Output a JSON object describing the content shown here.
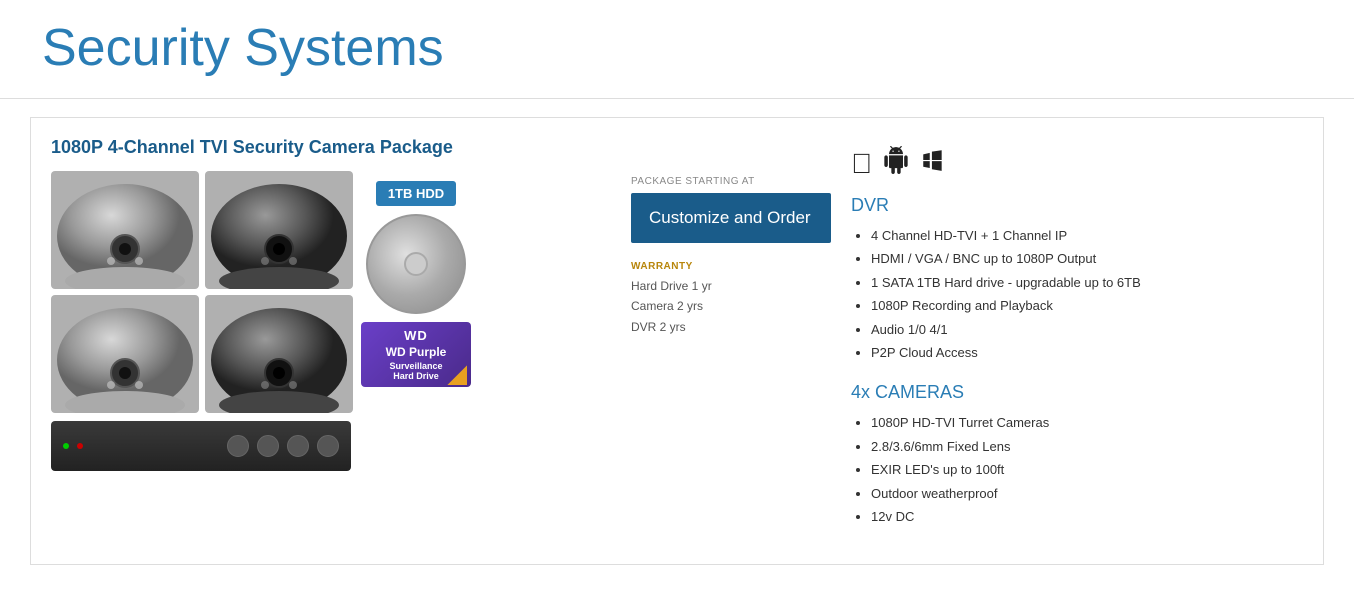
{
  "page": {
    "title": "Security Systems"
  },
  "product": {
    "title": "1080P 4-Channel TVI Security Camera Package",
    "hdd_badge": "1TB HDD",
    "package_starting_label": "package starting at",
    "customize_btn_label": "Customize and Order",
    "warranty_title": "WARRANTY",
    "warranty_lines": [
      "Hard Drive 1 yr",
      "Camera 2 yrs",
      "DVR 2 yrs"
    ],
    "platform_icons": [
      "apple",
      "android",
      "windows"
    ],
    "dvr_section_title": "DVR",
    "dvr_specs": [
      "4 Channel HD-TVI + 1 Channel IP",
      "HDMI / VGA / BNC up to 1080P Output",
      "1 SATA 1TB Hard drive - upgradable up to 6TB",
      "1080P Recording and Playback",
      "Audio 1/0 4/1",
      "P2P Cloud Access"
    ],
    "cameras_section_title": "4x CAMERAS",
    "camera_specs": [
      "1080P HD-TVI Turret Cameras",
      "2.8/3.6/6mm Fixed Lens",
      "EXIR LED's up to 100ft",
      "Outdoor weatherproof",
      "12v DC"
    ]
  },
  "colors": {
    "title_blue": "#2a7db5",
    "product_title_blue": "#1a5c8a",
    "btn_bg": "#1a5c8a",
    "warranty_gold": "#b8860b"
  }
}
